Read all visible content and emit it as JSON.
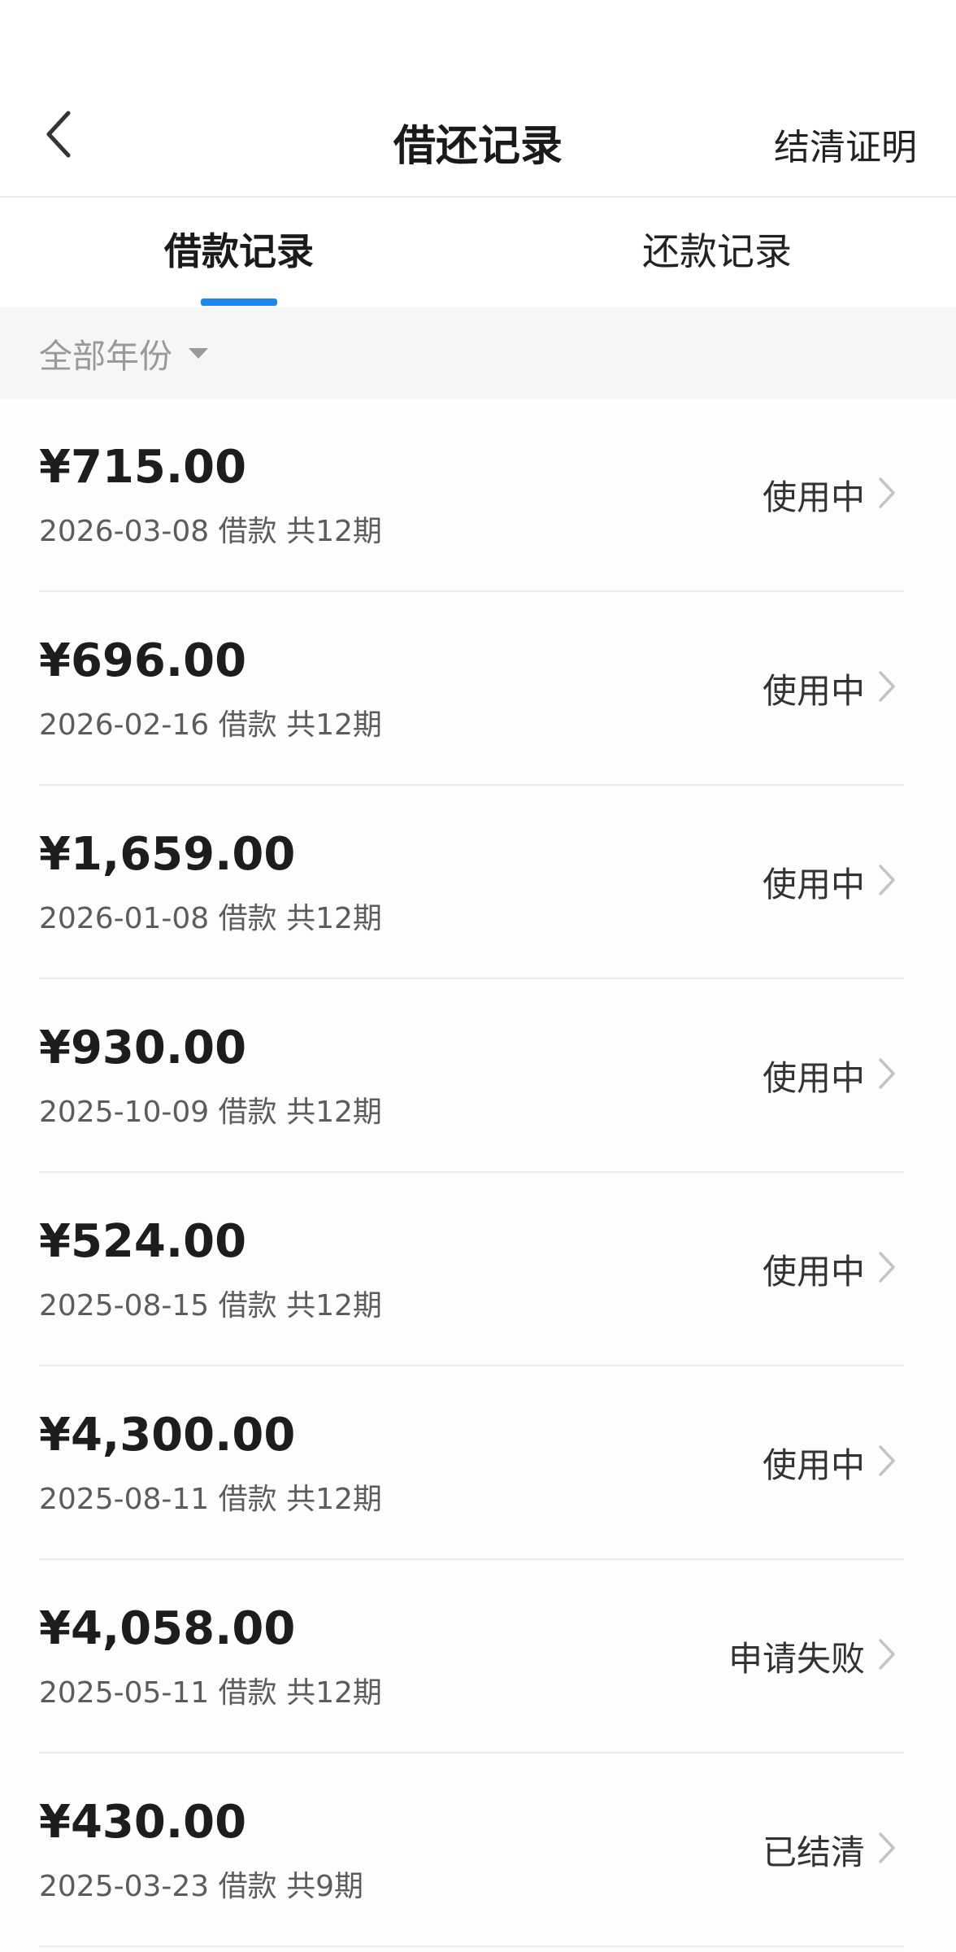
{
  "header": {
    "title": "借还记录",
    "action_label": "结清证明"
  },
  "tabs": [
    {
      "label": "借款记录",
      "active": true
    },
    {
      "label": "还款记录",
      "active": false
    }
  ],
  "filter": {
    "label": "全部年份"
  },
  "records": [
    {
      "amount": "¥715.00",
      "meta": "2026-03-08 借款 共12期",
      "status": "使用中"
    },
    {
      "amount": "¥696.00",
      "meta": "2026-02-16 借款 共12期",
      "status": "使用中"
    },
    {
      "amount": "¥1,659.00",
      "meta": "2026-01-08 借款 共12期",
      "status": "使用中"
    },
    {
      "amount": "¥930.00",
      "meta": "2025-10-09 借款 共12期",
      "status": "使用中"
    },
    {
      "amount": "¥524.00",
      "meta": "2025-08-15 借款 共12期",
      "status": "使用中"
    },
    {
      "amount": "¥4,300.00",
      "meta": "2025-08-11 借款 共12期",
      "status": "使用中"
    },
    {
      "amount": "¥4,058.00",
      "meta": "2025-05-11 借款 共12期",
      "status": "申请失败"
    },
    {
      "amount": "¥430.00",
      "meta": "2025-03-23 借款 共9期",
      "status": "已结清"
    }
  ],
  "colors": {
    "accent": "#1f86f0",
    "filter_background": "#f6f6f6",
    "secondary_text": "#999999"
  },
  "icons": {
    "back": "chevron-left-icon",
    "row": "chevron-right-icon",
    "filter": "caret-down-icon"
  }
}
